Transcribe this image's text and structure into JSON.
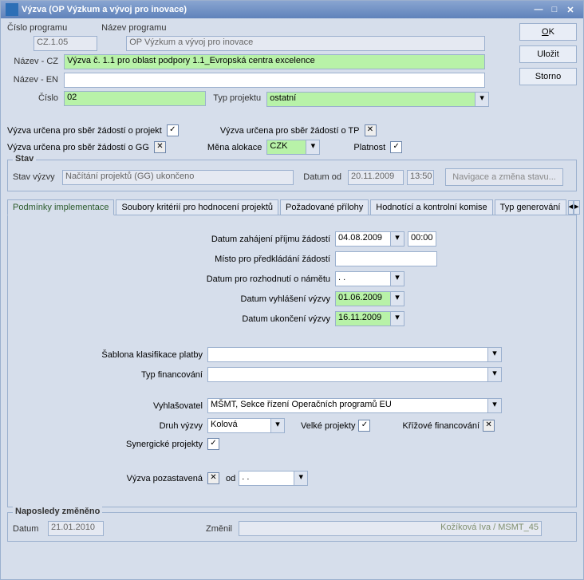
{
  "window": {
    "title": "Výzva  (OP Výzkum a vývoj pro inovace)"
  },
  "buttons": {
    "ok": "OK",
    "ulozit": "Uložit",
    "storno": "Storno",
    "navigace": "Navigace a změna stavu..."
  },
  "header": {
    "cislo_programu_lbl": "Číslo programu",
    "cislo_programu": "CZ.1.05",
    "nazev_programu_lbl": "Název programu",
    "nazev_programu": "OP Výzkum a vývoj pro inovace",
    "nazev_cz_lbl": "Název - CZ",
    "nazev_cz": "Výzva č. 1.1 pro oblast podpory 1.1_Evropská centra excelence",
    "nazev_en_lbl": "Název - EN",
    "nazev_en": "",
    "cislo_lbl": "Číslo",
    "cislo": "02",
    "typ_projektu_lbl": "Typ projektu",
    "typ_projektu": "ostatní"
  },
  "mid": {
    "sber_projekt": "Výzva určena pro sběr žádostí o projekt",
    "sber_gg": "Výzva určena pro sběr žádostí o GG",
    "sber_tp": "Výzva určena pro sběr žádostí o TP",
    "mena_lbl": "Měna alokace",
    "mena": "CZK",
    "platnost_lbl": "Platnost"
  },
  "stav": {
    "legend": "Stav",
    "stav_vyzvy_lbl": "Stav výzvy",
    "stav_vyzvy": "Načítání projektů (GG) ukončeno",
    "datum_od_lbl": "Datum od",
    "datum_od": "20.11.2009",
    "time": "13:50"
  },
  "tabs": {
    "t1": "Podmínky implementace",
    "t2": "Soubory kritérií pro hodnocení projektů",
    "t3": "Požadované přílohy",
    "t4": "Hodnotící a kontrolní komise",
    "t5": "Typ generování"
  },
  "impl": {
    "datum_zahajeni_lbl": "Datum zahájení příjmu žádostí",
    "datum_zahajeni": "04.08.2009",
    "cas_zahajeni": "00:00",
    "misto_lbl": "Místo pro předkládání žádostí",
    "misto": "",
    "datum_rozhodnuti_lbl": "Datum pro rozhodnutí o námětu",
    "datum_rozhodnuti": ".  .",
    "datum_vyhlaseni_lbl": "Datum vyhlášení výzvy",
    "datum_vyhlaseni": "01.06.2009",
    "datum_ukonceni_lbl": "Datum ukončení výzvy",
    "datum_ukonceni": "16.11.2009",
    "sablona_lbl": "Šablona klasifikace platby",
    "sablona": "",
    "typ_fin_lbl": "Typ financování",
    "typ_fin": "",
    "vyhlasovatel_lbl": "Vyhlašovatel",
    "vyhlasovatel": "MŠMT, Sekce  řízení Operačních programů EU",
    "druh_vyzvy_lbl": "Druh výzvy",
    "druh_vyzvy": "Kolová",
    "velke_projekty_lbl": "Velké projekty",
    "krizove_lbl": "Křížové financování",
    "synergicke_lbl": "Synergické projekty",
    "pozastavena_lbl": "Výzva pozastavená",
    "od_lbl": "od",
    "od": ".  ."
  },
  "footer": {
    "legend": "Naposledy změněno",
    "datum_lbl": "Datum",
    "datum": "21.01.2010",
    "zmenil_lbl": "Změnil",
    "zmenil": "Kožíková Iva  /  MSMT_45"
  }
}
